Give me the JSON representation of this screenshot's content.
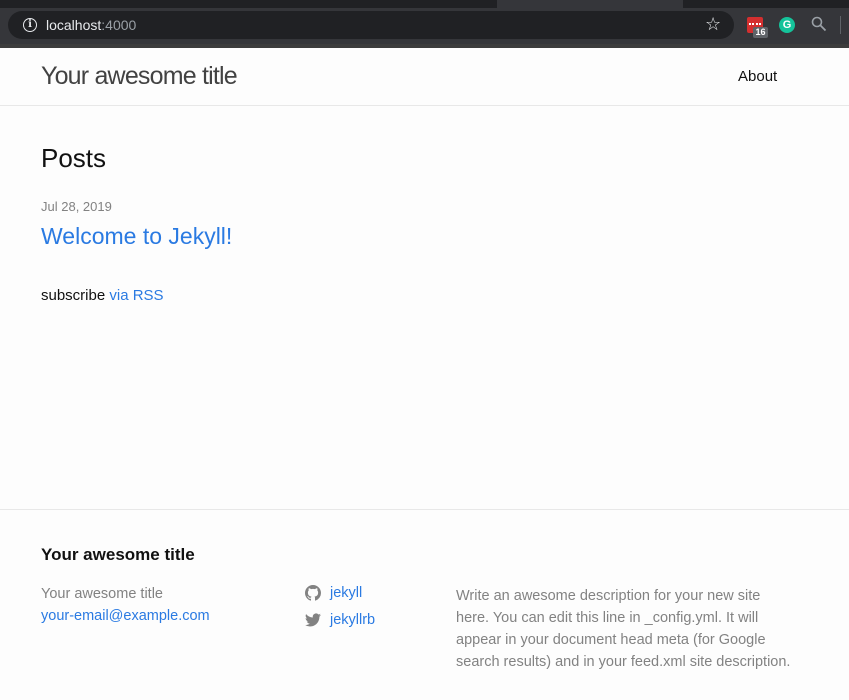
{
  "browser": {
    "url_host": "localhost",
    "url_port": ":4000",
    "extension_badge": "16",
    "grammarly_letter": "G",
    "icons": [
      "info-icon",
      "star-icon",
      "calendar-extension-icon",
      "grammarly-icon",
      "search-extension-icon"
    ]
  },
  "header": {
    "site_title": "Your awesome title",
    "nav": [
      {
        "label": "About"
      }
    ]
  },
  "main": {
    "heading": "Posts",
    "posts": [
      {
        "date": "Jul 28, 2019",
        "title": "Welcome to Jekyll!"
      }
    ],
    "rss_prefix": "subscribe ",
    "rss_link": "via RSS"
  },
  "footer": {
    "heading": "Your awesome title",
    "name": "Your awesome title",
    "email": "your-email@example.com",
    "social": [
      {
        "icon": "github-icon",
        "label": "jekyll"
      },
      {
        "icon": "twitter-icon",
        "label": "jekyllrb"
      }
    ],
    "description": "Write an awesome description for your new site here. You can edit this line in _config.yml. It will appear in your document head meta (for Google search results) and in your feed.xml site description.",
    "colors": {
      "link": "#2a7ae2",
      "muted": "#828282"
    }
  }
}
